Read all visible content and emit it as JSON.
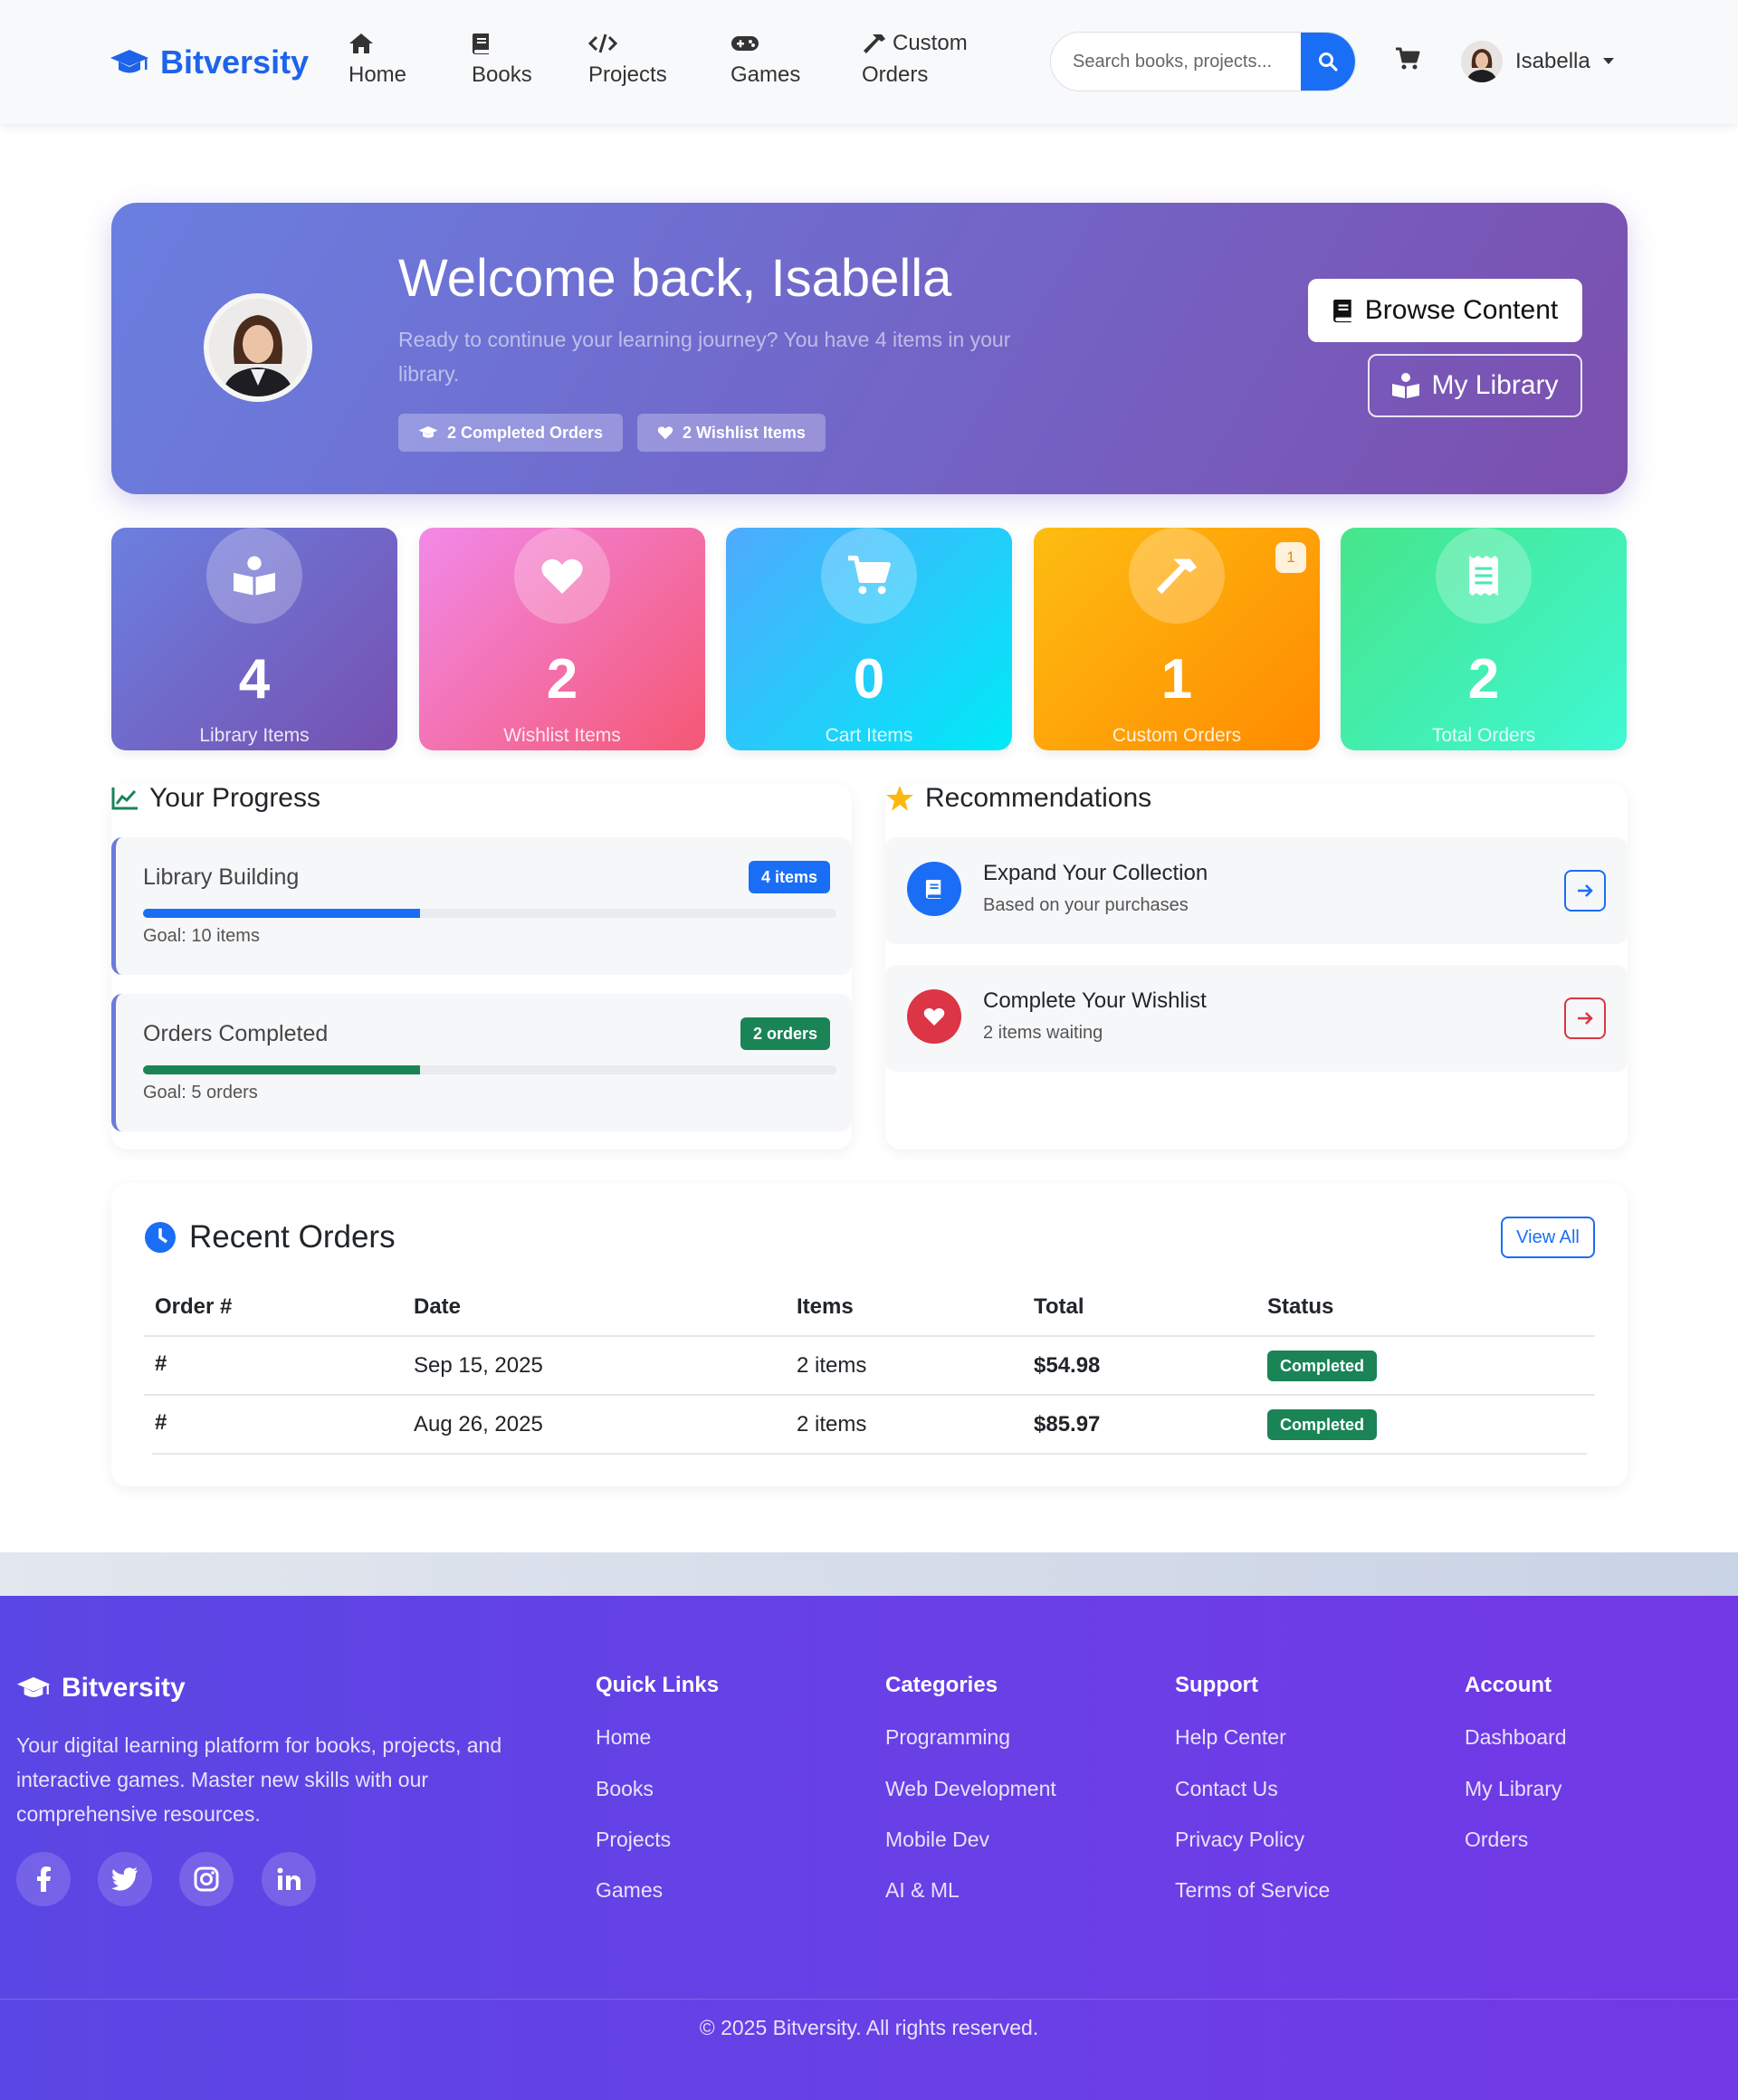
{
  "nav": {
    "brand": "Bitversity",
    "items": [
      {
        "label": "Home",
        "icon": "home-icon"
      },
      {
        "label": "Books",
        "icon": "book-icon"
      },
      {
        "label": "Projects",
        "icon": "code-icon"
      },
      {
        "label": "Games",
        "icon": "gamepad-icon"
      },
      {
        "label_line1": "Custom",
        "label_line2": "Orders",
        "icon": "hammer-icon"
      }
    ],
    "search_placeholder": "Search books, projects...",
    "user_name": "Isabella"
  },
  "hero": {
    "title": "Welcome back, Isabella",
    "subtitle": "Ready to continue your learning journey? You have 4 items in your library.",
    "badges": [
      "2 Completed Orders",
      "2 Wishlist Items"
    ],
    "browse_label": "Browse Content",
    "library_label": "My Library"
  },
  "stats": [
    {
      "value": "4",
      "label": "Library Items",
      "icon": "book-reader-icon"
    },
    {
      "value": "2",
      "label": "Wishlist Items",
      "icon": "heart-icon"
    },
    {
      "value": "0",
      "label": "Cart Items",
      "icon": "cart-icon"
    },
    {
      "value": "1",
      "label": "Custom Orders",
      "icon": "hammer-icon",
      "notification": "1"
    },
    {
      "value": "2",
      "label": "Total Orders",
      "icon": "receipt-icon"
    }
  ],
  "progress": {
    "title": "Your Progress",
    "items": [
      {
        "title": "Library Building",
        "badge": "4 items",
        "goal": "Goal: 10 items",
        "fraction": 0.4,
        "color": "#1a6ef5"
      },
      {
        "title": "Orders Completed",
        "badge": "2 orders",
        "goal": "Goal: 5 orders",
        "fraction": 0.4,
        "color": "#1a8457"
      }
    ]
  },
  "recommendations": {
    "title": "Recommendations",
    "items": [
      {
        "title": "Expand Your Collection",
        "subtitle": "Based on your purchases",
        "icon": "book-icon",
        "color": "#1a6ef5"
      },
      {
        "title": "Complete Your Wishlist",
        "subtitle": "2 items waiting",
        "icon": "heart-icon",
        "color": "#dc3545"
      }
    ]
  },
  "orders": {
    "title": "Recent Orders",
    "view_all": "View All",
    "columns": [
      "Order #",
      "Date",
      "Items",
      "Total",
      "Status"
    ],
    "rows": [
      {
        "order": "#",
        "date": "Sep 15, 2025",
        "items": "2 items",
        "total": "$54.98",
        "status": "Completed"
      },
      {
        "order": "#",
        "date": "Aug 26, 2025",
        "items": "2 items",
        "total": "$85.97",
        "status": "Completed"
      }
    ]
  },
  "footer": {
    "brand": "Bitversity",
    "description": "Your digital learning platform for books, projects, and interactive games. Master new skills with our comprehensive resources.",
    "social": [
      "facebook-icon",
      "twitter-icon",
      "instagram-icon",
      "linkedin-icon"
    ],
    "columns": [
      {
        "title": "Quick Links",
        "links": [
          "Home",
          "Books",
          "Projects",
          "Games"
        ]
      },
      {
        "title": "Categories",
        "links": [
          "Programming",
          "Web Development",
          "Mobile Dev",
          "AI & ML"
        ]
      },
      {
        "title": "Support",
        "links": [
          "Help Center",
          "Contact Us",
          "Privacy Policy",
          "Terms of Service"
        ]
      },
      {
        "title": "Account",
        "links": [
          "Dashboard",
          "My Library",
          "Orders"
        ]
      }
    ],
    "copyright": "© 2025 Bitversity. All rights reserved."
  }
}
